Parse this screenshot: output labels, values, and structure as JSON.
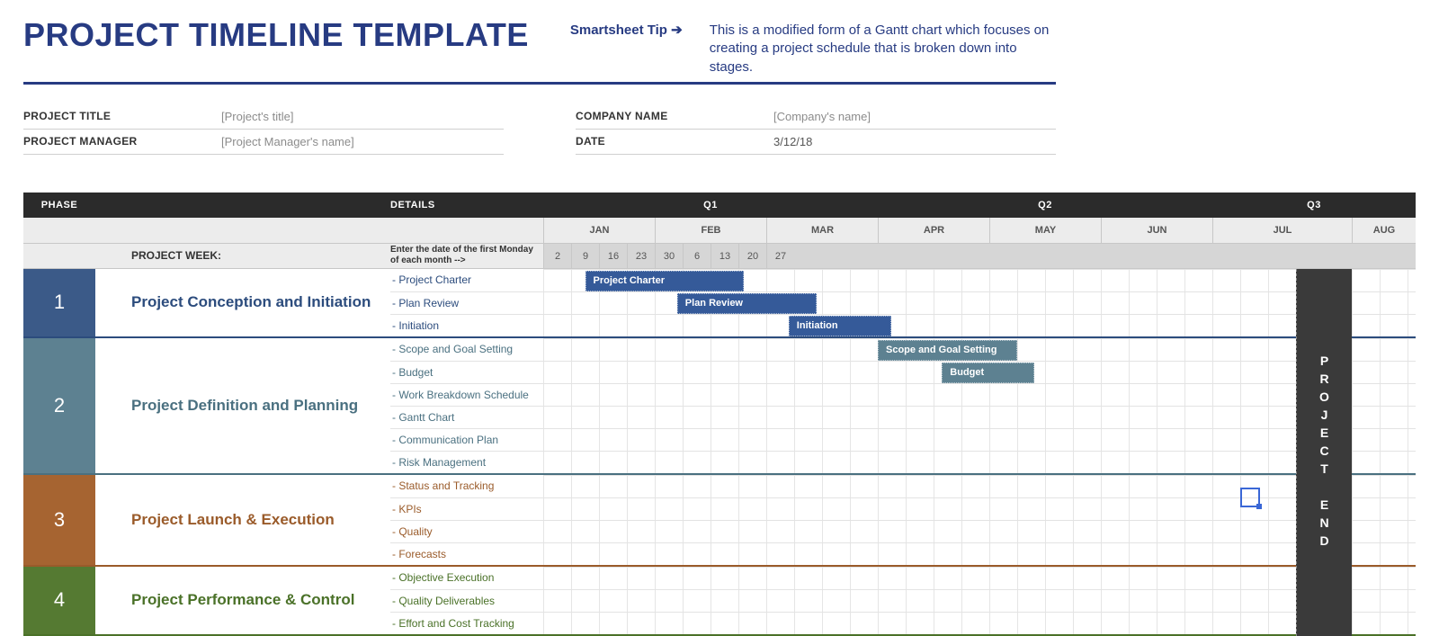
{
  "header": {
    "title": "PROJECT TIMELINE TEMPLATE",
    "tip_label": "Smartsheet Tip ➔",
    "tip_text": "This is a modified form of a Gantt chart which focuses on creating a project schedule that is broken down into stages."
  },
  "meta": {
    "left": [
      {
        "label": "PROJECT TITLE",
        "placeholder": "[Project's title]"
      },
      {
        "label": "PROJECT MANAGER",
        "placeholder": "[Project Manager's name]"
      }
    ],
    "right": [
      {
        "label": "COMPANY NAME",
        "placeholder": "[Company's name]"
      },
      {
        "label": "DATE",
        "value": "3/12/18"
      }
    ]
  },
  "columns": {
    "phase": "PHASE",
    "details": "DETAILS",
    "quarters": [
      "Q1",
      "Q2",
      "Q3"
    ],
    "months": [
      "JAN",
      "FEB",
      "MAR",
      "APR",
      "MAY",
      "JUN",
      "JUL",
      "AUG"
    ],
    "week_label": "PROJECT WEEK:",
    "week_hint": "Enter the date of the first Monday of each month -->",
    "week_days": [
      "2",
      "9",
      "16",
      "23",
      "30",
      "6",
      "13",
      "20",
      "27"
    ],
    "project_end": "PROJECT END"
  },
  "chart_data": {
    "type": "bar",
    "unit": "week-column (31px each), offsets measured from start of gantt-area",
    "phases": [
      {
        "num": "1",
        "title": "Project Conception and Initiation",
        "color": "c1",
        "details": [
          "- Project Charter",
          "- Plan Review",
          "- Initiation"
        ],
        "bars": [
          {
            "row": 0,
            "label": "Project Charter",
            "start": 1.5,
            "span": 5.7
          },
          {
            "row": 1,
            "label": "Plan Review",
            "start": 4.8,
            "span": 5.0
          },
          {
            "row": 2,
            "label": "Initiation",
            "start": 8.8,
            "span": 3.7
          }
        ]
      },
      {
        "num": "2",
        "title": "Project Definition and Planning",
        "color": "c2",
        "details": [
          "- Scope and Goal Setting",
          "- Budget",
          "- Work Breakdown Schedule",
          "- Gantt Chart",
          "- Communication Plan",
          "- Risk Management"
        ],
        "bars": [
          {
            "row": 0,
            "label": "Scope and Goal Setting",
            "start": 12.0,
            "span": 5.0
          },
          {
            "row": 1,
            "label": "Budget",
            "start": 14.3,
            "span": 3.3
          }
        ]
      },
      {
        "num": "3",
        "title": "Project Launch & Execution",
        "color": "c3",
        "details": [
          "- Status and Tracking",
          "- KPIs",
          "- Quality",
          "- Forecasts"
        ],
        "bars": []
      },
      {
        "num": "4",
        "title": "Project Performance & Control",
        "color": "c4",
        "details": [
          "- Objective Execution",
          "- Quality Deliverables",
          "- Effort and Cost Tracking"
        ],
        "bars": []
      }
    ],
    "project_end_col_at": 27.0,
    "selection_cell_at": 25.0
  }
}
